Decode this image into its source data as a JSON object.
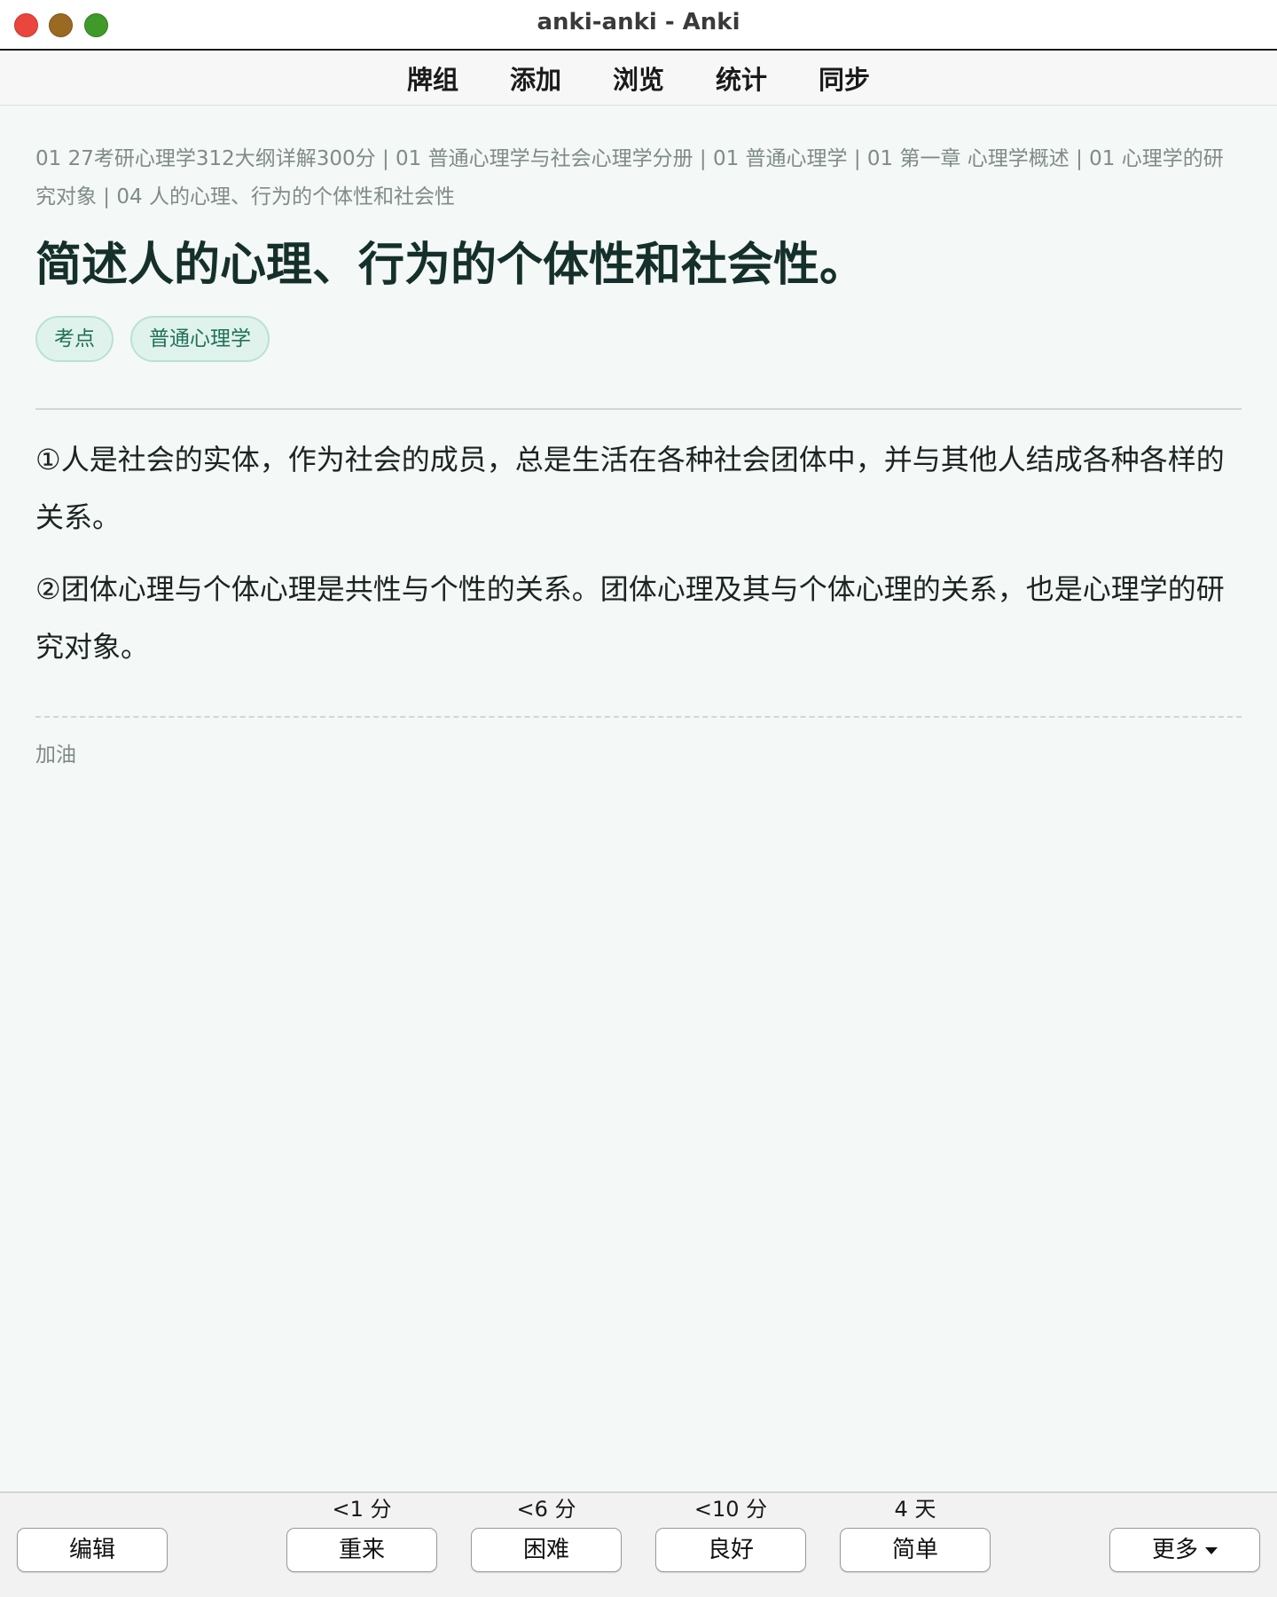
{
  "window": {
    "title": "anki-anki - Anki"
  },
  "nav": {
    "items": [
      "牌组",
      "添加",
      "浏览",
      "统计",
      "同步"
    ]
  },
  "card": {
    "breadcrumb": "01 27考研心理学312大纲详解300分 | 01 普通心理学与社会心理学分册 | 01 普通心理学 | 01 第一章 心理学概述 | 01 心理学的研究对象 | 04 人的心理、行为的个体性和社会性",
    "question": "简述人的心理、行为的个体性和社会性。",
    "tags": [
      "考点",
      "普通心理学"
    ],
    "answer": [
      "①人是社会的实体，作为社会的成员，总是生活在各种社会团体中，并与其他人结成各种各样的关系。",
      "②团体心理与个体心理是共性与个性的关系。团体心理及其与个体心理的关系，也是心理学的研究对象。"
    ],
    "note": "加油"
  },
  "bottom": {
    "edit_label": "编辑",
    "more_label": "更多",
    "answers": [
      {
        "interval": "<1 分",
        "label": "重来"
      },
      {
        "interval": "<6 分",
        "label": "困难"
      },
      {
        "interval": "<10 分",
        "label": "良好"
      },
      {
        "interval": "4 天",
        "label": "简单"
      }
    ]
  },
  "colors": {
    "background": "#f4f8f7",
    "tag_bg": "#dff3ec",
    "tag_text": "#22705a",
    "question_text": "#15302a",
    "close": "#e9473e",
    "minimize": "#9a6a23",
    "maximize": "#3f9a2a"
  }
}
